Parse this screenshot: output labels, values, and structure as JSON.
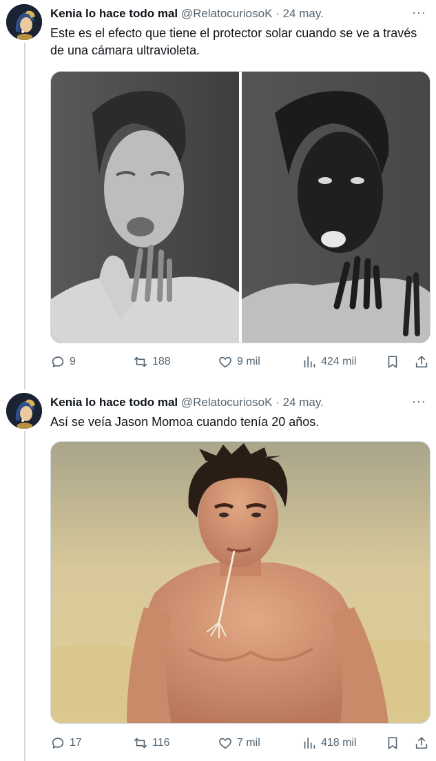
{
  "tweets": [
    {
      "author_name": "Kenia lo hace todo mal",
      "handle": "@RelatocuriosoK",
      "separator": "·",
      "date": "24 may.",
      "more": "···",
      "text": "Este es el efecto que tiene el protector solar cuando se ve a través de una cámara ultravioleta.",
      "replies": "9",
      "reposts": "188",
      "likes": "9 mil",
      "views": "424 mil"
    },
    {
      "author_name": "Kenia lo hace todo mal",
      "handle": "@RelatocuriosoK",
      "separator": "·",
      "date": "24 may.",
      "more": "···",
      "text": "Así se veía Jason Momoa cuando tenía 20 años.",
      "replies": "17",
      "reposts": "116",
      "likes": "7 mil",
      "views": "418 mil"
    }
  ],
  "colors": {
    "text_primary": "#0f1419",
    "text_secondary": "#536471",
    "thread_line": "#cfd9de"
  },
  "icons": [
    "reply-icon",
    "repost-icon",
    "like-icon",
    "views-icon",
    "bookmark-icon",
    "share-icon",
    "more-icon"
  ]
}
